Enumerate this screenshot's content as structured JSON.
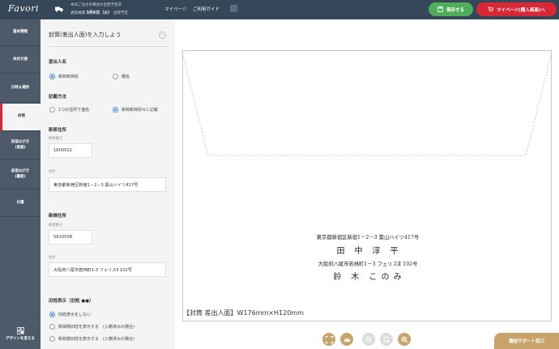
{
  "header": {
    "logo": "Favori",
    "shipping_line1": "本日ご注文の場合の出荷予定日",
    "shipping_line2_prefix": "通常納期",
    "shipping_date": "3月6日（火）",
    "shipping_line2_suffix": "出荷予定",
    "nav_mypage": "マイページ",
    "nav_guide": "ご利用ガイド",
    "save_label": "保存する",
    "mypage_button_label": "マイページ(購入画面)へ"
  },
  "sidebar": {
    "items": [
      {
        "label": "基本情報"
      },
      {
        "label": "本状文面"
      },
      {
        "label": "日時＆場所"
      },
      {
        "label": "封筒"
      },
      {
        "label": "返信はがき\n(表面)"
      },
      {
        "label": "返信はがき\n(裏面)"
      },
      {
        "label": "付箋"
      }
    ],
    "design_change_label": "デザインを変える"
  },
  "form": {
    "title": "封筒(差出人面)を入力しよう",
    "help": "?",
    "sender_section": "差出人名",
    "sender_options": [
      "新郎新婦名",
      "親名"
    ],
    "method_section": "記載方法",
    "method_options": [
      "1つの住所で連名",
      "新郎新婦別々に記載"
    ],
    "groom_section": "新郎住所",
    "bride_section": "新婦住所",
    "postal_label": "郵便番号",
    "address_label": "住所",
    "groom_postal": "1600022",
    "groom_address": "東京都新宿区新宿1－2－3 葉山ハイツ417号",
    "bride_postal": "5810038",
    "bride_address": "大阪府八尾市若林町1-3 フェリスⅡ 102号",
    "oldname_section": "旧姓表示（旧姓 ●●）",
    "oldname_options": [
      "旧姓表示をしない",
      "新婦側旧姓を表示する　(入籍済みの場合)",
      "新郎側旧姓を表示する　(入籍済みの場合)"
    ]
  },
  "preview": {
    "groom_address": "東京都新宿区新宿1－2－3 葉山ハイツ417号",
    "groom_name": "田　中　淳　平",
    "bride_address": "大阪府八尾市若林町1－3 フェリスⅡ 102号",
    "bride_name": "鈴　木　こ の み",
    "caption": "【封筒 差出人面】W176mm×H120mm"
  },
  "toolbar": {
    "tools": [
      "fullscreen-icon",
      "crown-icon",
      "zoom-out-icon",
      "zoom-reset-icon",
      "zoom-in-icon"
    ]
  },
  "support": {
    "label": "電話サポート窓口"
  },
  "colors": {
    "header_bg": "#37475a",
    "sidebar_bg": "#4c5a6a",
    "save_green": "#4fae5a",
    "mypage_red": "#d82836",
    "tool_gold": "#c9a46a",
    "radio_blue": "#4a8fe0"
  }
}
